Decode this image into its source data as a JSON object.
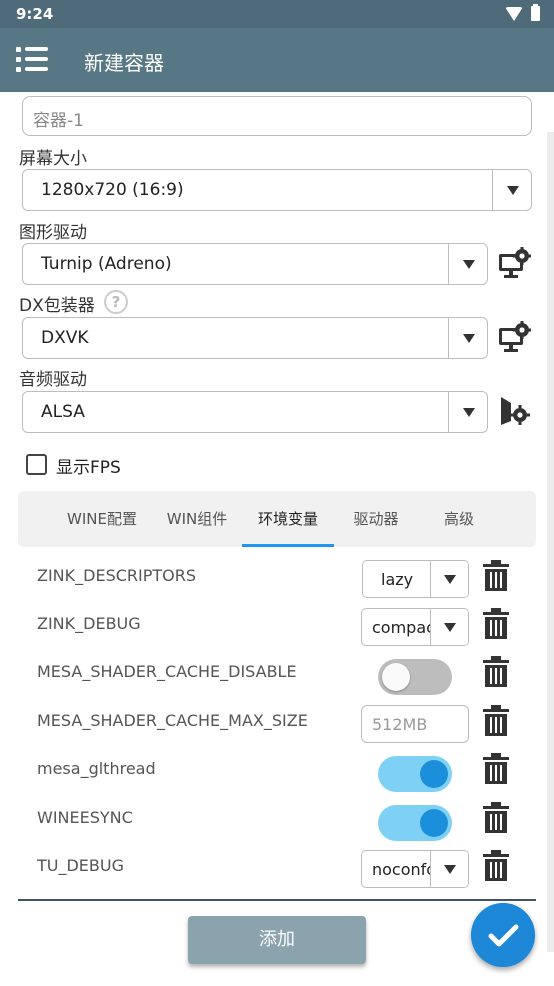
{
  "status_bar": {
    "time": "9:24"
  },
  "app_bar": {
    "title": "新建容器"
  },
  "name_field": {
    "value": "容器-1"
  },
  "screen_size": {
    "label": "屏幕大小",
    "value": "1280x720 (16:9)"
  },
  "graphics_driver": {
    "label": "图形驱动",
    "value": "Turnip (Adreno)"
  },
  "dx_wrapper": {
    "label": "DX包装器",
    "help": "?",
    "value": "DXVK"
  },
  "audio_driver": {
    "label": "音频驱动",
    "value": "ALSA"
  },
  "show_fps": {
    "label": "显示FPS",
    "checked": false
  },
  "tabs": [
    {
      "label": "WINE配置",
      "active": false
    },
    {
      "label": "WIN组件",
      "active": false
    },
    {
      "label": "环境变量",
      "active": true
    },
    {
      "label": "驱动器",
      "active": false
    },
    {
      "label": "高级",
      "active": false
    }
  ],
  "env_vars": [
    {
      "key": "ZINK_DESCRIPTORS",
      "control": "select",
      "value": "lazy"
    },
    {
      "key": "ZINK_DEBUG",
      "control": "select",
      "value": "compact"
    },
    {
      "key": "MESA_SHADER_CACHE_DISABLE",
      "control": "toggle",
      "on": false
    },
    {
      "key": "MESA_SHADER_CACHE_MAX_SIZE",
      "control": "text",
      "placeholder": "512MB"
    },
    {
      "key": "mesa_glthread",
      "control": "toggle",
      "on": true
    },
    {
      "key": "WINEESYNC",
      "control": "toggle",
      "on": true
    },
    {
      "key": "TU_DEBUG",
      "control": "select",
      "value": "noconform"
    }
  ],
  "add_button": {
    "label": "添加"
  },
  "colors": {
    "app_bar": "#587785",
    "status_bar": "#4f6a78",
    "accent": "#2196f3",
    "toggle_on_track": "#7fd0f5",
    "toggle_on_knob": "#1b8fd9",
    "add_button": "#8aa3ad",
    "fab": "#1e88d8"
  },
  "icons": {
    "menu": "hamburger-icon",
    "graphics_settings": "monitor-gear-icon",
    "dx_settings": "monitor-gear-icon",
    "audio_settings": "speaker-gear-icon",
    "delete": "trash-icon",
    "confirm": "check-icon"
  }
}
